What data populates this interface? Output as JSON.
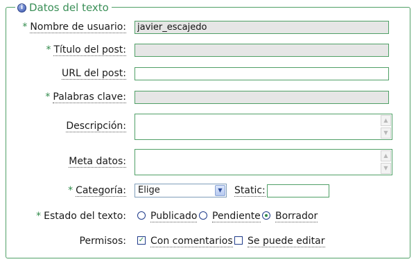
{
  "section": {
    "legend": "Datos del texto",
    "info_icon": "info-icon"
  },
  "required_mark": "*",
  "fields": {
    "usuario": {
      "label": "Nombre de usuario:",
      "value": "javier_escajedo"
    },
    "titulo": {
      "label": "Título del post:",
      "value": ""
    },
    "url": {
      "label": "URL del post:",
      "value": ""
    },
    "palabras": {
      "label": "Palabras clave:",
      "value": ""
    },
    "descripcion": {
      "label": "Descripción:"
    },
    "meta": {
      "label": "Meta datos:"
    },
    "categoria": {
      "label": "Categoría:",
      "selected": "Elige"
    },
    "static": {
      "label": "Static:",
      "value": ""
    }
  },
  "estado": {
    "label": "Estado del texto:",
    "options": [
      {
        "label": "Publicado",
        "checked": false
      },
      {
        "label": "Pendiente",
        "checked": false
      },
      {
        "label": "Borrador",
        "checked": true
      }
    ]
  },
  "permisos": {
    "label": "Permisos:",
    "options": [
      {
        "label": "Con comentarios",
        "checked": true
      },
      {
        "label": "Se puede editar",
        "checked": false
      }
    ]
  },
  "colors": {
    "accent": "#4f9f66",
    "required": "#2f8a4a",
    "readonly_bg": "#e6e6e6"
  }
}
